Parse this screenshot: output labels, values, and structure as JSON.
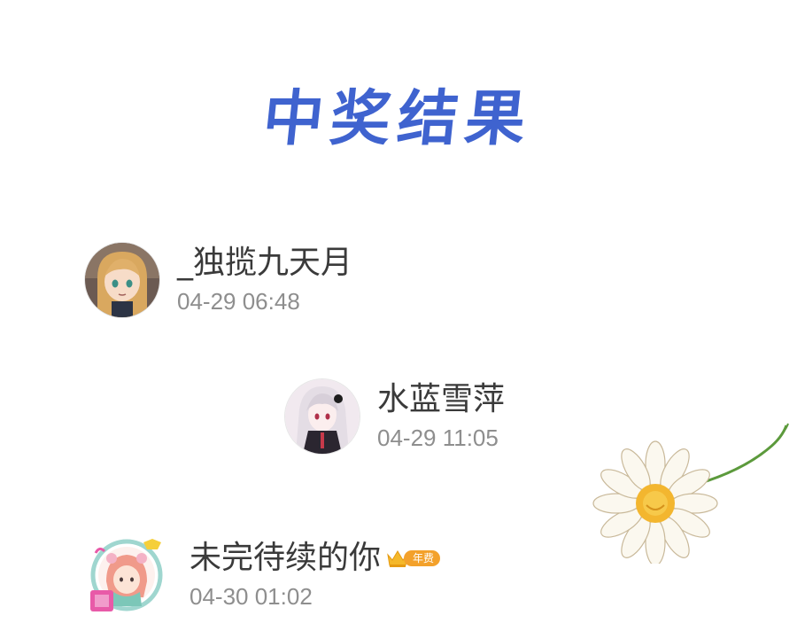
{
  "title": "中奖结果",
  "winners": [
    {
      "name": "_独揽九天月",
      "time": "04-29 06:48",
      "avatar": "anime-girl-blonde-avatar"
    },
    {
      "name": "水蓝雪萍",
      "time": "04-29 11:05",
      "avatar": "anime-girl-silver-hair-avatar"
    },
    {
      "name": "未完待续的你",
      "time": "04-30 01:02",
      "avatar": "anime-girl-pink-hair-frame-avatar",
      "badge": "年费"
    }
  ],
  "colors": {
    "title": "#3f63cf",
    "name": "#3a3a3a",
    "time": "#8e8e8e",
    "badge": "#f3a12b"
  }
}
